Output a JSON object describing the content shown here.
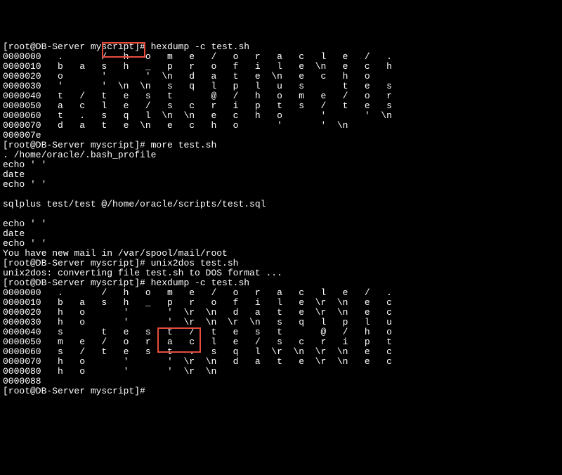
{
  "prompt_prefix": "[root@DB-Server myscript]# ",
  "commands": {
    "cmd1": "hexdump -c test.sh",
    "cmd2": "more test.sh",
    "cmd3": "unix2dos test.sh",
    "cmd4": "hexdump -c test.sh"
  },
  "hexdump1_rows": [
    {
      "offset": "0000000",
      "chars": [
        ".",
        " ",
        "/",
        "h",
        "o",
        "m",
        "e",
        "/",
        "o",
        "r",
        "a",
        "c",
        "l",
        "e",
        "/",
        "."
      ]
    },
    {
      "offset": "0000010",
      "chars": [
        "b",
        "a",
        "s",
        "h",
        "_",
        "p",
        "r",
        "o",
        "f",
        "i",
        "l",
        "e",
        "\\n",
        "e",
        "c",
        "h"
      ]
    },
    {
      "offset": "0000020",
      "chars": [
        "o",
        " ",
        "'",
        " ",
        "'",
        "\\n",
        "d",
        "a",
        "t",
        "e",
        "\\n",
        "e",
        "c",
        "h",
        "o",
        " "
      ]
    },
    {
      "offset": "0000030",
      "chars": [
        "'",
        " ",
        "'",
        "\\n",
        "\\n",
        "s",
        "q",
        "l",
        "p",
        "l",
        "u",
        "s",
        " ",
        "t",
        "e",
        "s"
      ]
    },
    {
      "offset": "0000040",
      "chars": [
        "t",
        "/",
        "t",
        "e",
        "s",
        "t",
        " ",
        "@",
        "/",
        "h",
        "o",
        "m",
        "e",
        "/",
        "o",
        "r"
      ]
    },
    {
      "offset": "0000050",
      "chars": [
        "a",
        "c",
        "l",
        "e",
        "/",
        "s",
        "c",
        "r",
        "i",
        "p",
        "t",
        "s",
        "/",
        "t",
        "e",
        "s"
      ]
    },
    {
      "offset": "0000060",
      "chars": [
        "t",
        ".",
        "s",
        "q",
        "l",
        "\\n",
        "\\n",
        "e",
        "c",
        "h",
        "o",
        " ",
        "'",
        " ",
        "'",
        "\\n"
      ]
    },
    {
      "offset": "0000070",
      "chars": [
        "d",
        "a",
        "t",
        "e",
        "\\n",
        "e",
        "c",
        "h",
        "o",
        " ",
        "'",
        " ",
        "'",
        "\\n",
        "",
        ""
      ]
    }
  ],
  "hexdump1_end": "000007e",
  "more_output": [
    ". /home/oracle/.bash_profile",
    "echo ' '",
    "date",
    "echo ' '",
    "",
    "sqlplus test/test @/home/oracle/scripts/test.sql",
    "",
    "echo ' '",
    "date",
    "echo ' '",
    "You have new mail in /var/spool/mail/root"
  ],
  "unix2dos_output": "unix2dos: converting file test.sh to DOS format ...",
  "hexdump2_rows": [
    {
      "offset": "0000000",
      "chars": [
        ".",
        " ",
        "/",
        "h",
        "o",
        "m",
        "e",
        "/",
        "o",
        "r",
        "a",
        "c",
        "l",
        "e",
        "/",
        "."
      ]
    },
    {
      "offset": "0000010",
      "chars": [
        "b",
        "a",
        "s",
        "h",
        "_",
        "p",
        "r",
        "o",
        "f",
        "i",
        "l",
        "e",
        "\\r",
        "\\n",
        "e",
        "c"
      ]
    },
    {
      "offset": "0000020",
      "chars": [
        "h",
        "o",
        " ",
        "'",
        " ",
        "'",
        "\\r",
        "\\n",
        "d",
        "a",
        "t",
        "e",
        "\\r",
        "\\n",
        "e",
        "c"
      ]
    },
    {
      "offset": "0000030",
      "chars": [
        "h",
        "o",
        " ",
        "'",
        " ",
        "'",
        "\\r",
        "\\n",
        "\\r",
        "\\n",
        "s",
        "q",
        "l",
        "p",
        "l",
        "u"
      ]
    },
    {
      "offset": "0000040",
      "chars": [
        "s",
        " ",
        "t",
        "e",
        "s",
        "t",
        "/",
        "t",
        "e",
        "s",
        "t",
        " ",
        "@",
        "/",
        "h",
        "o"
      ]
    },
    {
      "offset": "0000050",
      "chars": [
        "m",
        "e",
        "/",
        "o",
        "r",
        "a",
        "c",
        "l",
        "e",
        "/",
        "s",
        "c",
        "r",
        "i",
        "p",
        "t"
      ]
    },
    {
      "offset": "0000060",
      "chars": [
        "s",
        "/",
        "t",
        "e",
        "s",
        "t",
        ".",
        "s",
        "q",
        "l",
        "\\r",
        "\\n",
        "\\r",
        "\\n",
        "e",
        "c"
      ]
    },
    {
      "offset": "0000070",
      "chars": [
        "h",
        "o",
        " ",
        "'",
        " ",
        "'",
        "\\r",
        "\\n",
        "d",
        "a",
        "t",
        "e",
        "\\r",
        "\\n",
        "e",
        "c"
      ]
    },
    {
      "offset": "0000080",
      "chars": [
        "h",
        "o",
        " ",
        "'",
        " ",
        "'",
        "\\r",
        "\\n",
        "",
        "",
        "",
        "",
        "",
        "",
        "",
        ""
      ]
    }
  ],
  "hexdump2_end": "0000088",
  "final_prompt": "[root@DB-Server myscript]# "
}
